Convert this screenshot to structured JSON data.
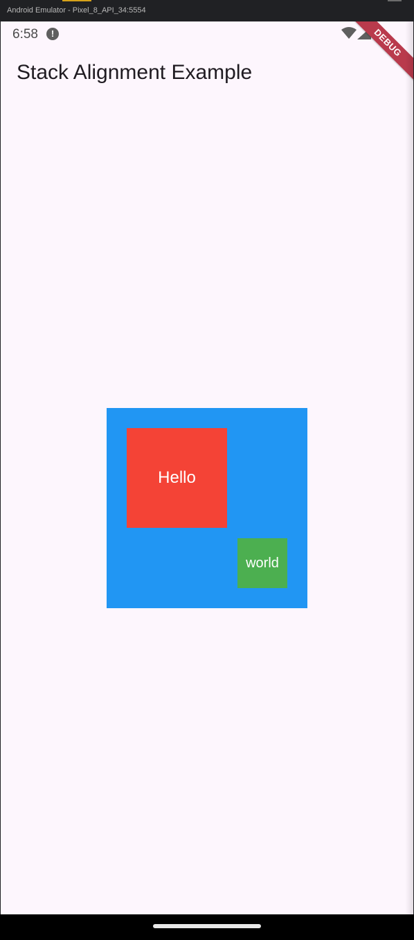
{
  "window": {
    "title": "Android Emulator - Pixel_8_API_34:5554"
  },
  "status_bar": {
    "time": "6:58",
    "alert_glyph": "!",
    "icons": [
      "alert-icon",
      "wifi-icon",
      "cell-signal-icon"
    ]
  },
  "debug_banner": {
    "label": "DEBUG"
  },
  "app_bar": {
    "title": "Stack Alignment Example"
  },
  "stack": {
    "boxes": [
      {
        "label": "Hello",
        "color": "#f44336"
      },
      {
        "label": "world",
        "color": "#4caf50"
      }
    ],
    "background_color": "#2196f3"
  },
  "colors": {
    "screen_background": "#fdf6fd",
    "debug_ribbon": "#b93a4c"
  }
}
